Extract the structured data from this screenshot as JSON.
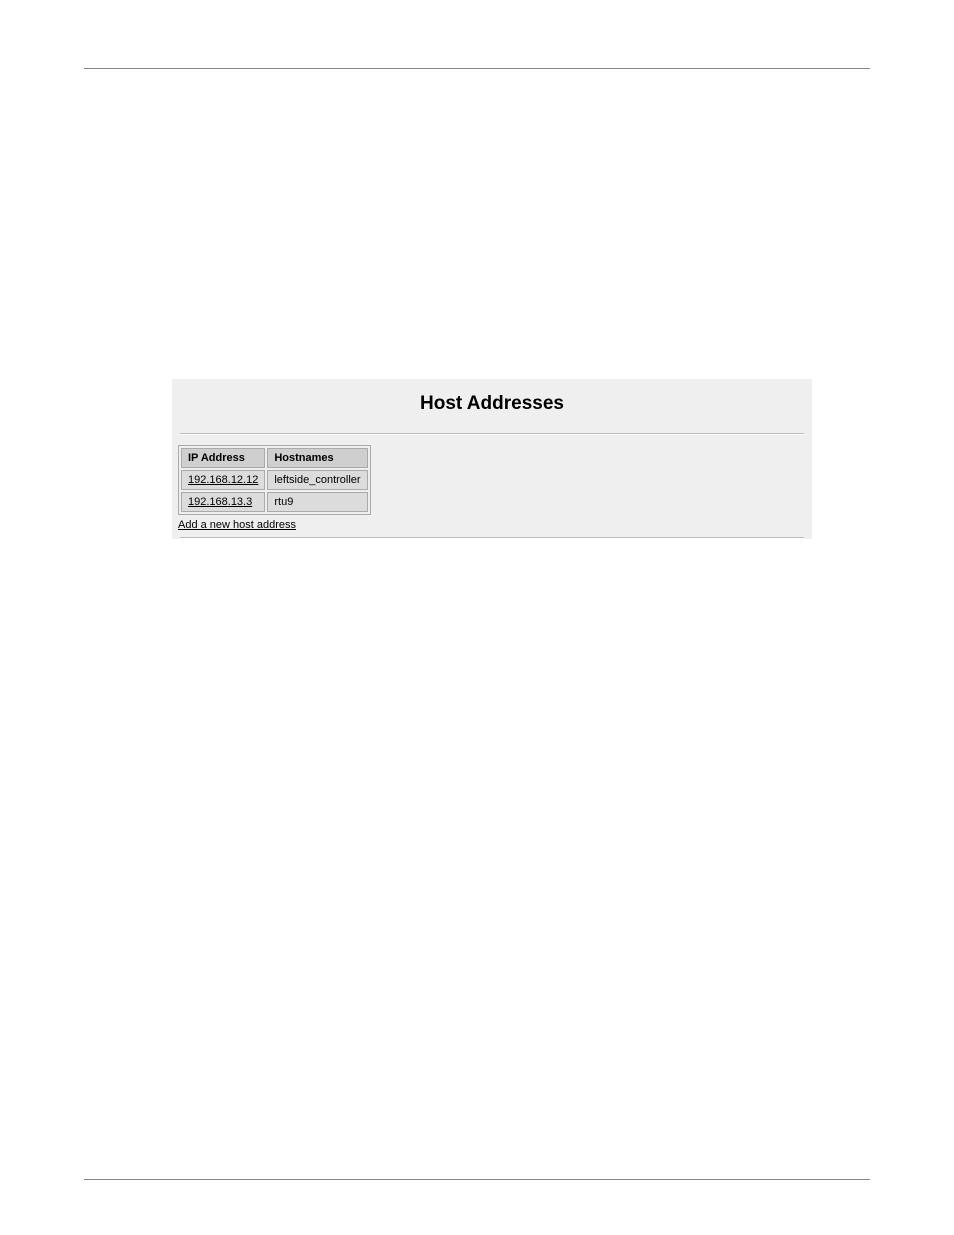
{
  "panel": {
    "title": "Host Addresses",
    "table": {
      "headers": {
        "ip": "IP Address",
        "hostnames": "Hostnames"
      },
      "rows": [
        {
          "ip": "192.168.12.12",
          "hostname": "leftside_controller"
        },
        {
          "ip": "192.168.13.3",
          "hostname": "rtu9"
        }
      ]
    },
    "add_link": "Add a new host address"
  }
}
